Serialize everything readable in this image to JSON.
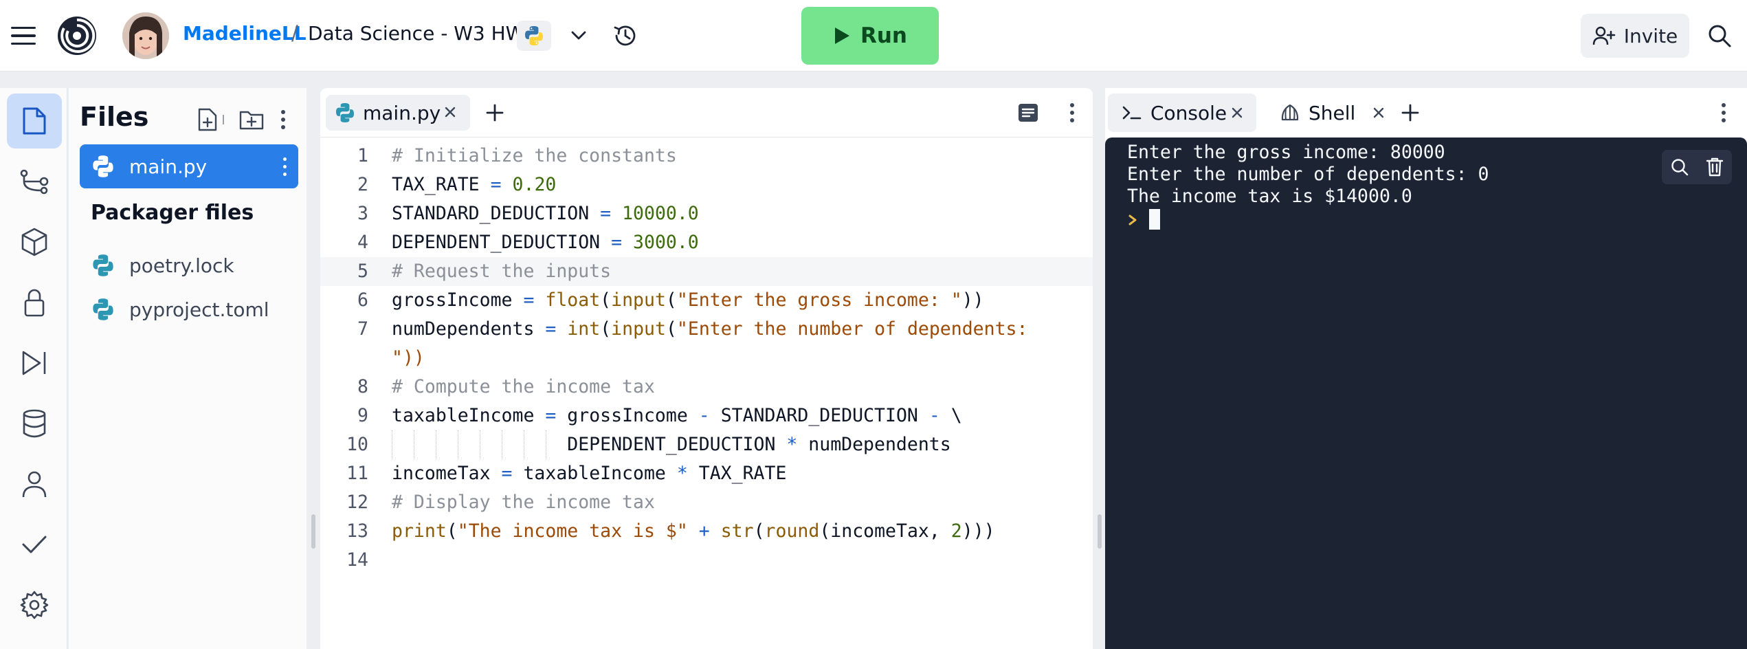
{
  "topbar": {
    "username": "MadelineLL",
    "separator": "/",
    "project_name": "Data Science - W3 HW",
    "run_label": "Run",
    "invite_label": "Invite",
    "run_color": "#76e38f",
    "accent_color": "#0079f2"
  },
  "rail": {
    "items": [
      "files-icon",
      "git-branch-icon",
      "packages-icon",
      "secrets-lock-icon",
      "workflows-play-icon",
      "database-icon",
      "user-icon",
      "checkmark-icon",
      "settings-gear-icon"
    ],
    "active": "files-icon"
  },
  "files": {
    "title": "Files",
    "items": [
      {
        "name": "main.py",
        "icon": "python-icon",
        "selected": true
      }
    ],
    "packager_title": "Packager files",
    "packager_items": [
      {
        "name": "poetry.lock",
        "icon": "python-icon"
      },
      {
        "name": "pyproject.toml",
        "icon": "python-icon"
      }
    ]
  },
  "editor": {
    "tab_label": "main.py",
    "current_line": 5,
    "lines": [
      {
        "n": "1",
        "text": "# Initialize the constants"
      },
      {
        "n": "2",
        "text": "TAX_RATE = 0.20"
      },
      {
        "n": "3",
        "text": "STANDARD_DEDUCTION = 10000.0"
      },
      {
        "n": "4",
        "text": "DEPENDENT_DEDUCTION = 3000.0"
      },
      {
        "n": "5",
        "text": "# Request the inputs"
      },
      {
        "n": "6",
        "text": "grossIncome = float(input(\"Enter the gross income: \"))"
      },
      {
        "n": "7",
        "text": "numDependents = int(input(\"Enter the number of dependents:"
      },
      {
        "n": "",
        "text": "\"))"
      },
      {
        "n": "8",
        "text": "# Compute the income tax"
      },
      {
        "n": "9",
        "text": "taxableIncome = grossIncome - STANDARD_DEDUCTION - \\"
      },
      {
        "n": "10",
        "text": "                DEPENDENT_DEDUCTION * numDependents"
      },
      {
        "n": "11",
        "text": "incomeTax = taxableIncome * TAX_RATE"
      },
      {
        "n": "12",
        "text": "# Display the income tax"
      },
      {
        "n": "13",
        "text": "print(\"The income tax is $\" + str(round(incomeTax, 2)))"
      },
      {
        "n": "14",
        "text": ""
      }
    ]
  },
  "console": {
    "tabs": [
      {
        "label": "Console",
        "icon": "terminal-prompt-icon",
        "active": true
      },
      {
        "label": "Shell",
        "icon": "shell-icon",
        "active": false
      }
    ],
    "output": [
      "Enter the gross income: 80000",
      "Enter the number of dependents: 0",
      "The income tax is $14000.0"
    ],
    "background": "#1c2333"
  }
}
